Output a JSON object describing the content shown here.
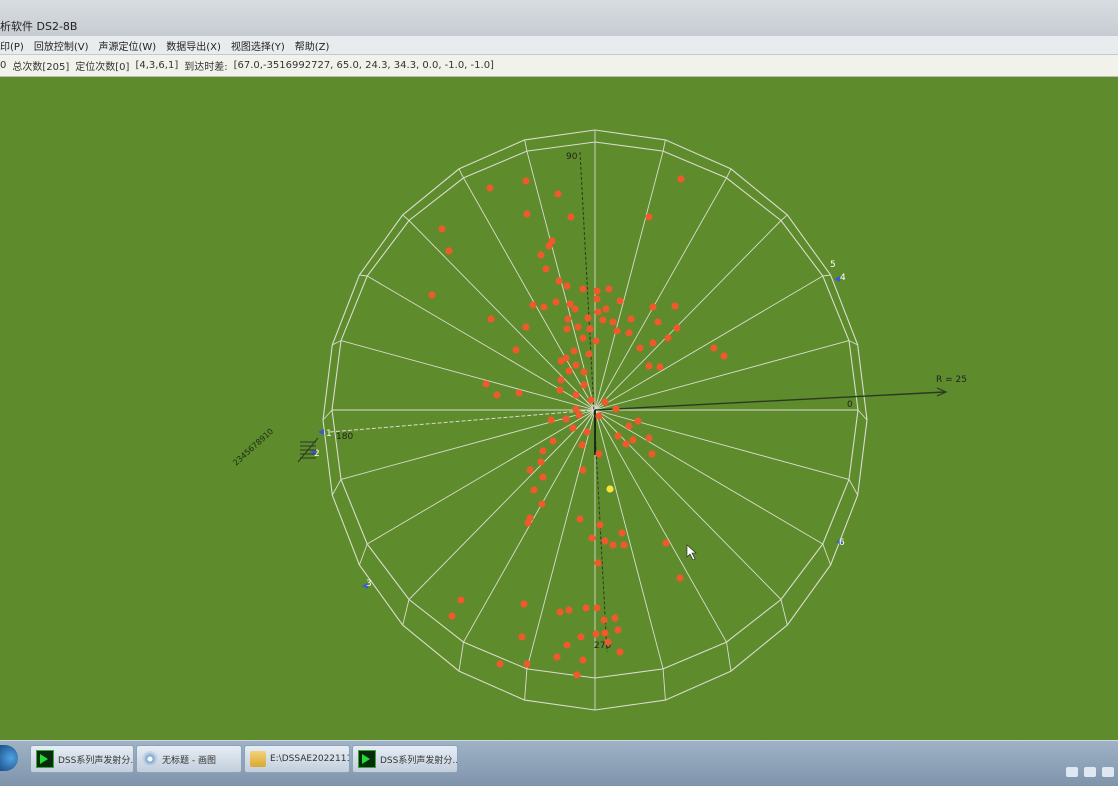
{
  "window": {
    "title": "析软件 DS2-8B"
  },
  "menu": [
    {
      "label": "印(P)"
    },
    {
      "label": "回放控制(V)"
    },
    {
      "label": "声源定位(W)"
    },
    {
      "label": "数据导出(X)"
    },
    {
      "label": "视图选择(Y)"
    },
    {
      "label": "帮助(Z)"
    }
  ],
  "status": {
    "prefix": "0",
    "total": "总次数[205]",
    "locate": "定位次数[0]",
    "coords": "[4,3,6,1]",
    "arrival_label": "到达时差:",
    "arrival_values": "[67.0,-3516992727, 65.0, 24.3, 34.3, 0.0, -1.0, -1.0]"
  },
  "plot": {
    "axis_top_label": "90",
    "axis_left_label": "180",
    "axis_right_label": "0",
    "axis_bottom_label": "270",
    "radius_label": "R = 25",
    "sensor_labels": [
      "1",
      "2",
      "3",
      "4",
      "5",
      "6"
    ],
    "side_label": "2345678910",
    "colors": {
      "background": "#5e8b2b",
      "events": "#ee5a2c",
      "highlight": "#f4e53a",
      "grid": "#d9dccf"
    },
    "events": [
      [
        490,
        188
      ],
      [
        526,
        181
      ],
      [
        558,
        194
      ],
      [
        681,
        179
      ],
      [
        527,
        214
      ],
      [
        571,
        217
      ],
      [
        649,
        217
      ],
      [
        442,
        229
      ],
      [
        449,
        251
      ],
      [
        432,
        295
      ],
      [
        552,
        241
      ],
      [
        549,
        246
      ],
      [
        541,
        255
      ],
      [
        546,
        269
      ],
      [
        559,
        281
      ],
      [
        567,
        286
      ],
      [
        583,
        289
      ],
      [
        556,
        302
      ],
      [
        570,
        304
      ],
      [
        597,
        291
      ],
      [
        609,
        289
      ],
      [
        544,
        307
      ],
      [
        533,
        305
      ],
      [
        597,
        299
      ],
      [
        575,
        309
      ],
      [
        588,
        318
      ],
      [
        598,
        312
      ],
      [
        603,
        320
      ],
      [
        620,
        301
      ],
      [
        606,
        309
      ],
      [
        568,
        319
      ],
      [
        578,
        327
      ],
      [
        567,
        329
      ],
      [
        590,
        329
      ],
      [
        583,
        338
      ],
      [
        596,
        341
      ],
      [
        613,
        322
      ],
      [
        631,
        319
      ],
      [
        629,
        333
      ],
      [
        617,
        331
      ],
      [
        653,
        307
      ],
      [
        675,
        306
      ],
      [
        658,
        322
      ],
      [
        677,
        328
      ],
      [
        668,
        338
      ],
      [
        653,
        343
      ],
      [
        640,
        348
      ],
      [
        491,
        319
      ],
      [
        526,
        327
      ],
      [
        516,
        350
      ],
      [
        574,
        351
      ],
      [
        566,
        358
      ],
      [
        576,
        365
      ],
      [
        589,
        354
      ],
      [
        584,
        372
      ],
      [
        569,
        371
      ],
      [
        561,
        380
      ],
      [
        584,
        385
      ],
      [
        576,
        395
      ],
      [
        591,
        400
      ],
      [
        576,
        409
      ],
      [
        566,
        419
      ],
      [
        573,
        428
      ],
      [
        587,
        432
      ],
      [
        579,
        415
      ],
      [
        605,
        402
      ],
      [
        616,
        409
      ],
      [
        638,
        421
      ],
      [
        629,
        426
      ],
      [
        618,
        436
      ],
      [
        633,
        440
      ],
      [
        649,
        438
      ],
      [
        652,
        454
      ],
      [
        626,
        444
      ],
      [
        599,
        416
      ],
      [
        486,
        384
      ],
      [
        497,
        395
      ],
      [
        519,
        393
      ],
      [
        561,
        361
      ],
      [
        560,
        390
      ],
      [
        551,
        420
      ],
      [
        553,
        441
      ],
      [
        543,
        451
      ],
      [
        541,
        462
      ],
      [
        530,
        470
      ],
      [
        543,
        477
      ],
      [
        534,
        490
      ],
      [
        542,
        504
      ],
      [
        530,
        518
      ],
      [
        528,
        523
      ],
      [
        582,
        445
      ],
      [
        599,
        454
      ],
      [
        583,
        470
      ],
      [
        580,
        519
      ],
      [
        600,
        525
      ],
      [
        605,
        541
      ],
      [
        613,
        545
      ],
      [
        622,
        533
      ],
      [
        624,
        545
      ],
      [
        592,
        538
      ],
      [
        598,
        563
      ],
      [
        666,
        543
      ],
      [
        680,
        578
      ],
      [
        714,
        348
      ],
      [
        724,
        356
      ],
      [
        660,
        367
      ],
      [
        649,
        366
      ],
      [
        461,
        600
      ],
      [
        452,
        616
      ],
      [
        524,
        604
      ],
      [
        560,
        612
      ],
      [
        569,
        610
      ],
      [
        586,
        608
      ],
      [
        597,
        608
      ],
      [
        604,
        620
      ],
      [
        615,
        618
      ],
      [
        618,
        630
      ],
      [
        605,
        633
      ],
      [
        596,
        634
      ],
      [
        608,
        642
      ],
      [
        581,
        637
      ],
      [
        567,
        645
      ],
      [
        557,
        657
      ],
      [
        522,
        637
      ],
      [
        500,
        664
      ],
      [
        527,
        664
      ],
      [
        583,
        660
      ],
      [
        577,
        675
      ],
      [
        620,
        652
      ]
    ],
    "highlight_event": [
      610,
      489
    ]
  },
  "taskbar": {
    "items": [
      {
        "label": "DSS系列声发射分..."
      },
      {
        "label": "无标题 - 画图"
      },
      {
        "label": "E:\\DSSAE2022111..."
      },
      {
        "label": "DSS系列声发射分..."
      }
    ]
  }
}
